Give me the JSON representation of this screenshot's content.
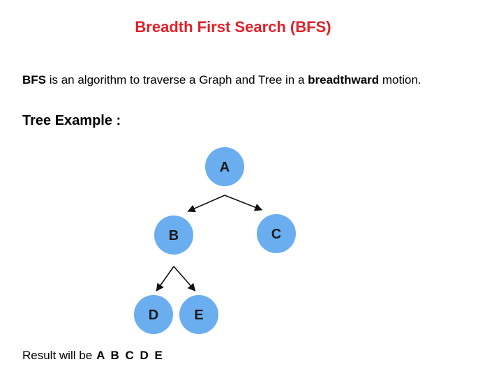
{
  "title": "Breadth First Search (BFS)",
  "intro": {
    "term": "BFS",
    "text_before": " is an algorithm to traverse a Graph and Tree in a ",
    "emphasis": "breadthward",
    "text_after": " motion."
  },
  "section_heading": "Tree Example :",
  "tree": {
    "nodes": [
      {
        "id": "A",
        "label": "A"
      },
      {
        "id": "B",
        "label": "B"
      },
      {
        "id": "C",
        "label": "C"
      },
      {
        "id": "D",
        "label": "D"
      },
      {
        "id": "E",
        "label": "E"
      }
    ],
    "edges": [
      {
        "from": "A",
        "to": "B"
      },
      {
        "from": "A",
        "to": "C"
      },
      {
        "from": "B",
        "to": "D"
      },
      {
        "from": "B",
        "to": "E"
      }
    ],
    "node_color": "#6aaef0",
    "edge_color": "#111111"
  },
  "result": {
    "label": "Result will be",
    "sequence": "A B C D E"
  }
}
